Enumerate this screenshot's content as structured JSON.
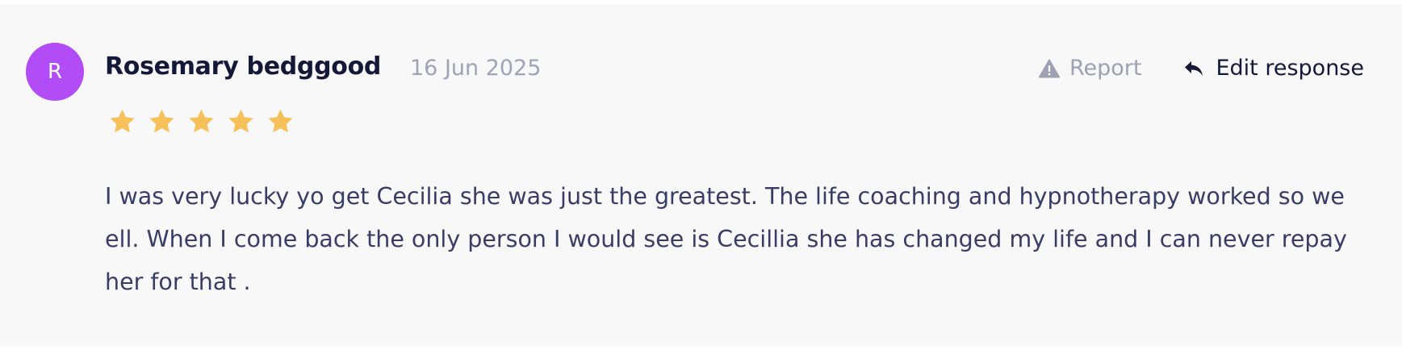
{
  "review": {
    "avatar_initial": "R",
    "avatar_color": "#b14cf6",
    "author": "Rosemary bedggood",
    "date": "16 Jun 2025",
    "rating": 5,
    "max_rating": 5,
    "star_color": "#f7c15a",
    "text": "I was very lucky yo get Cecilia she was just the greatest. The life coaching and hypnotherapy worked so we ell. When I come back the only person I would see is Cecillia she has changed my life and I can never repay her for that ."
  },
  "actions": {
    "report_label": "Report",
    "report_icon": "warning-triangle-icon",
    "edit_label": "Edit response",
    "edit_icon": "reply-arrow-icon"
  }
}
